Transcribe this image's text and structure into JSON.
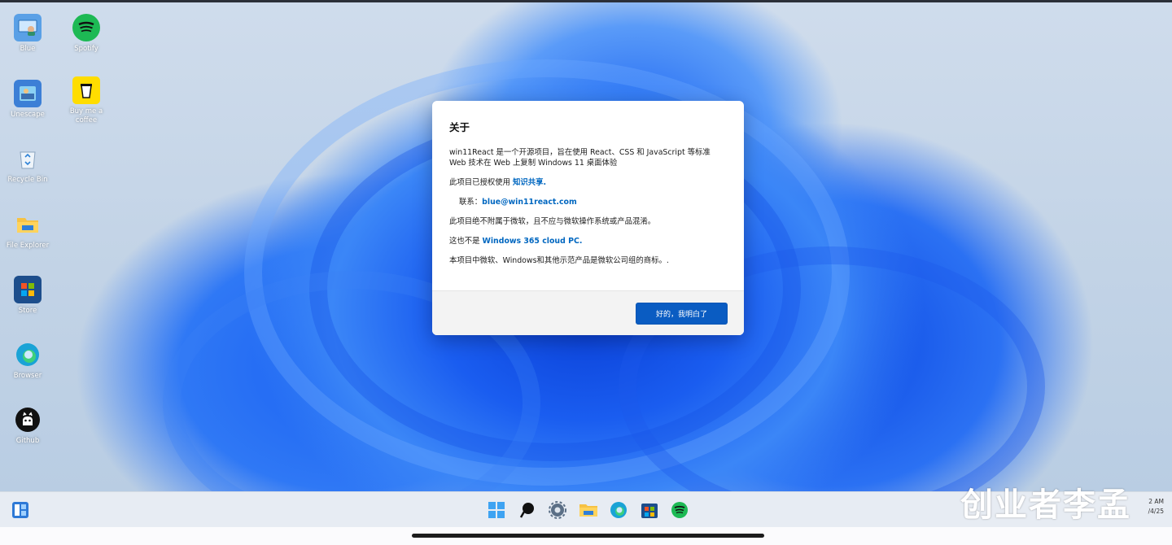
{
  "desktop": {
    "icons": [
      {
        "label": "Blue",
        "icon": "user-pc-icon"
      },
      {
        "label": "Spotify",
        "icon": "spotify-icon"
      },
      {
        "label": "Unescape",
        "icon": "unescape-icon"
      },
      {
        "label": "Buy me a coffee",
        "icon": "coffee-cup-icon"
      },
      {
        "label": "Recycle Bin",
        "icon": "recycle-bin-icon"
      },
      {
        "label": "File Explorer",
        "icon": "folder-icon"
      },
      {
        "label": "Store",
        "icon": "store-icon"
      },
      {
        "label": "Browser",
        "icon": "edge-icon"
      },
      {
        "label": "Github",
        "icon": "github-icon"
      }
    ]
  },
  "dialog": {
    "title": "关于",
    "intro": "win11React 是一个开源项目，旨在使用 React、CSS 和 JavaScript 等标准 Web 技术在 Web 上复制 Windows 11 桌面体验",
    "license_prefix": "此项目已授权使用",
    "license_link": "知识共享.",
    "contact_prefix": "联系：",
    "contact_link": "blue@win11react.com",
    "disclaimer": "此项目绝不附属于微软，且不应与微软操作系统或产品混淆。",
    "notice_prefix": "这也不是",
    "notice_link": "Windows 365 cloud PC.",
    "trademark": "本项目中微软、Windows和其他示范产品是微软公司组的商标。.",
    "ok_label": "好的，我明白了"
  },
  "taskbar": {
    "apps": [
      "start-icon",
      "search-icon",
      "settings-icon",
      "file-explorer-icon",
      "edge-icon",
      "store-icon",
      "spotify-icon"
    ],
    "time": "2 AM",
    "date": "/4/25"
  },
  "watermark": "创业者李孟",
  "colors": {
    "accent": "#0a5cc2",
    "link": "#0067c0",
    "taskbar": "#e7ecf3"
  }
}
